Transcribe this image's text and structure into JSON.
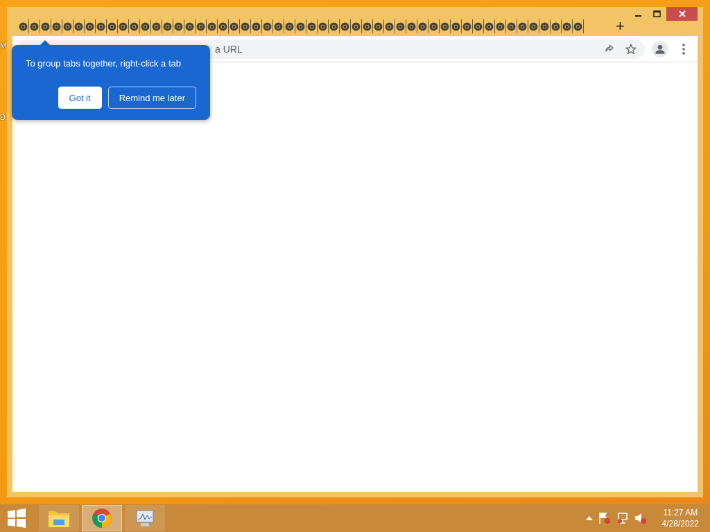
{
  "desktop_icons": [
    {
      "label": "M"
    },
    {
      "label": "D"
    }
  ],
  "browser": {
    "tabs": [
      {
        "selected": false
      },
      {
        "selected": false
      },
      {
        "selected": false
      },
      {
        "selected": false
      },
      {
        "selected": false
      },
      {
        "selected": false
      },
      {
        "selected": false
      },
      {
        "selected": false
      },
      {
        "selected": false
      },
      {
        "selected": false
      },
      {
        "selected": false
      },
      {
        "selected": false
      },
      {
        "selected": false
      },
      {
        "selected": false
      },
      {
        "selected": false
      },
      {
        "selected": false
      },
      {
        "selected": false
      },
      {
        "selected": false
      },
      {
        "selected": false
      },
      {
        "selected": false
      },
      {
        "selected": false
      },
      {
        "selected": false
      },
      {
        "selected": false
      },
      {
        "selected": false
      },
      {
        "selected": false
      },
      {
        "selected": false
      },
      {
        "selected": false
      },
      {
        "selected": false
      },
      {
        "selected": false
      },
      {
        "selected": false
      },
      {
        "selected": false
      },
      {
        "selected": false
      },
      {
        "selected": false
      },
      {
        "selected": false
      },
      {
        "selected": false
      },
      {
        "selected": false
      },
      {
        "selected": false
      },
      {
        "selected": false
      },
      {
        "selected": false
      },
      {
        "selected": false
      },
      {
        "selected": false
      },
      {
        "selected": false
      },
      {
        "selected": false
      },
      {
        "selected": false
      },
      {
        "selected": false
      },
      {
        "selected": false
      },
      {
        "selected": false
      },
      {
        "selected": false
      },
      {
        "selected": false
      },
      {
        "selected": false
      },
      {
        "selected": false
      }
    ],
    "new_tab": "+",
    "address_bar": {
      "value": "a URL"
    },
    "bubble": {
      "message": "To group tabs together, right-click a tab",
      "buttons": [
        {
          "label": "Got it",
          "kind": "primary"
        },
        {
          "label": "Remind me later",
          "kind": "secondary"
        }
      ]
    }
  },
  "taskbar": {
    "apps": [
      {
        "kind": "explorer",
        "selected": false
      },
      {
        "kind": "chrome",
        "selected": true
      },
      {
        "kind": "monitor",
        "selected": false
      }
    ],
    "clock": {
      "time": "11:27 AM",
      "date": "4/28/2022"
    }
  }
}
